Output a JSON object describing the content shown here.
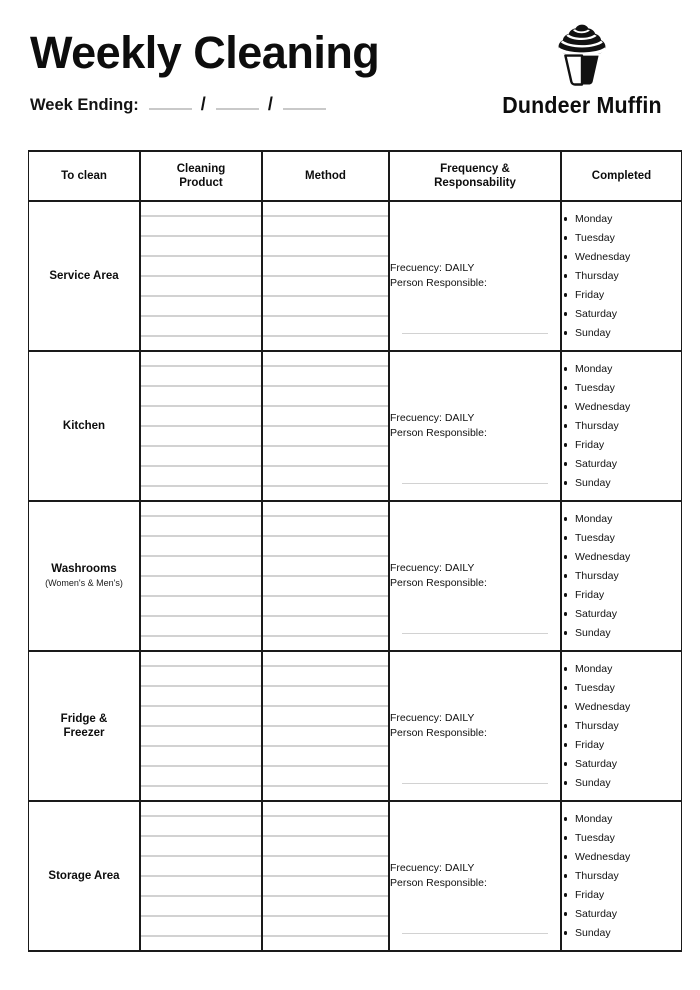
{
  "header": {
    "title": "Weekly Cleaning",
    "week_ending_label": "Week Ending:",
    "date_separator": "/",
    "date_blanks": [
      "",
      "",
      ""
    ]
  },
  "logo": {
    "icon": "cupcake-icon",
    "brand_name": "Dundeer Muffin"
  },
  "table": {
    "columns": [
      {
        "key": "to_clean",
        "label": "To clean"
      },
      {
        "key": "product",
        "label": "Cleaning\nProduct",
        "line1": "Cleaning",
        "line2": "Product"
      },
      {
        "key": "method",
        "label": "Method"
      },
      {
        "key": "frequency",
        "label": "Frequency &\nResponsability",
        "line1": "Frequency &",
        "line2": "Responsability"
      },
      {
        "key": "completed",
        "label": "Completed"
      }
    ],
    "write_lines_per_cell": 7,
    "frequency_text": {
      "frequency": "Frecuency: DAILY",
      "person": "Person Responsible:"
    },
    "days": [
      "Monday",
      "Tuesday",
      "Wednesday",
      "Thursday",
      "Friday",
      "Saturday",
      "Sunday"
    ],
    "rows": [
      {
        "area": "Service Area",
        "area_sub": ""
      },
      {
        "area": "Kitchen",
        "area_sub": ""
      },
      {
        "area": "Washrooms",
        "area_sub": "(Women's & Men's)"
      },
      {
        "area": "Fridge &\nFreezer",
        "area_line1": "Fridge &",
        "area_line2": "Freezer",
        "area_sub": ""
      },
      {
        "area": "Storage Area",
        "area_sub": ""
      }
    ]
  },
  "colors": {
    "ink": "#111111",
    "rule": "#1a1a1a",
    "write_line": "#d2d2d2"
  }
}
